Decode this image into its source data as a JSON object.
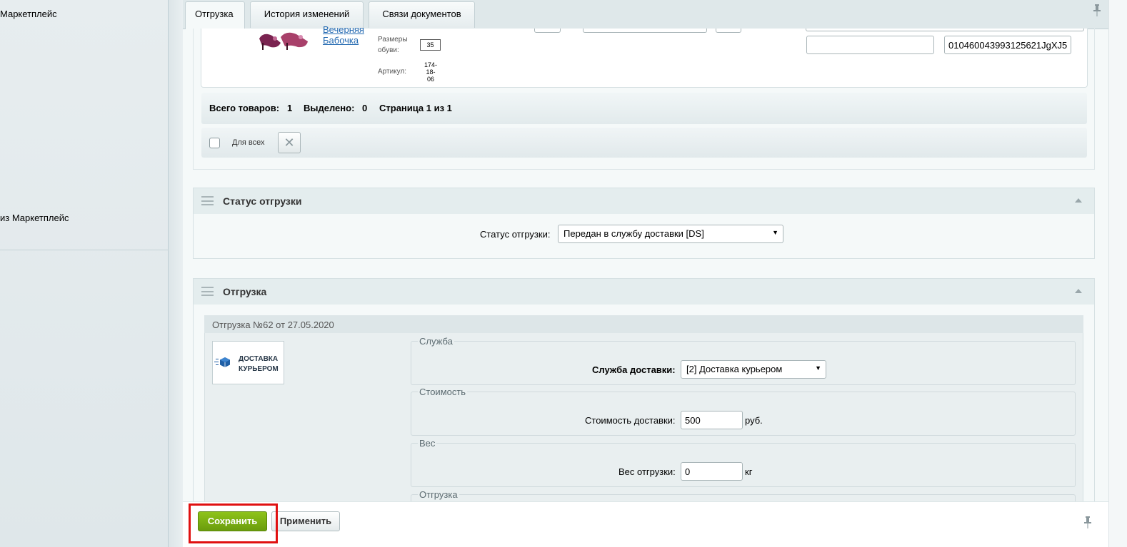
{
  "sidebar": {
    "items": [
      {
        "label": "Маркетплейс"
      },
      {
        "label": "из Маркетплейс"
      }
    ]
  },
  "tabs": [
    {
      "label": "Отгрузка",
      "active": true
    },
    {
      "label": "История изменений",
      "active": false
    },
    {
      "label": "Связи документов",
      "active": false
    }
  ],
  "product": {
    "name_line1": "Вечерняя",
    "name_line2": "Бабочка",
    "shoe_size_label_1": "Размеры",
    "shoe_size_label_2": "обуви:",
    "shoe_size_value": "35",
    "article_label": "Артикул:",
    "article_value_1": "174-",
    "article_value_2": "18-",
    "article_value_3": "06",
    "input1_value": "",
    "input2_value": "010460043993125621JgXJ5"
  },
  "summary": {
    "total_label": "Всего товаров:",
    "total_value": "1",
    "selected_label": "Выделено:",
    "selected_value": "0",
    "page_text": "Страница 1 из 1"
  },
  "actions": {
    "for_all_label": "Для всех",
    "delete_glyph": "✕"
  },
  "status_section": {
    "title": "Статус отгрузки",
    "field_label": "Статус отгрузки:",
    "field_value": "Передан в службу доставки [DS]"
  },
  "shipment_section": {
    "title": "Отгрузка",
    "shipment_title": "Отгрузка №62 от 27.05.2020",
    "logo_line1": "ДОСТАВКА",
    "logo_line2": "КУРЬЕРОМ",
    "service_legend": "Служба",
    "service_label": "Служба доставки:",
    "service_value": "[2] Доставка курьером",
    "cost_legend": "Стоимость",
    "cost_label": "Стоимость доставки:",
    "cost_value": "500",
    "cost_unit": "руб.",
    "weight_legend": "Вес",
    "weight_label": "Вес отгрузки:",
    "weight_value": "0",
    "weight_unit": "кг",
    "shipment_legend": "Отгрузка"
  },
  "footer": {
    "save_label": "Сохранить",
    "apply_label": "Применить"
  },
  "icons": {
    "pin": "pin-icon",
    "drag": "drag-handle-icon",
    "collapse": "collapse-icon",
    "dropdown": "dropdown-arrow-icon",
    "box": "box-icon"
  },
  "colors": {
    "save_button": "#7cb012",
    "highlight": "#e01010",
    "link": "#2067b0"
  }
}
